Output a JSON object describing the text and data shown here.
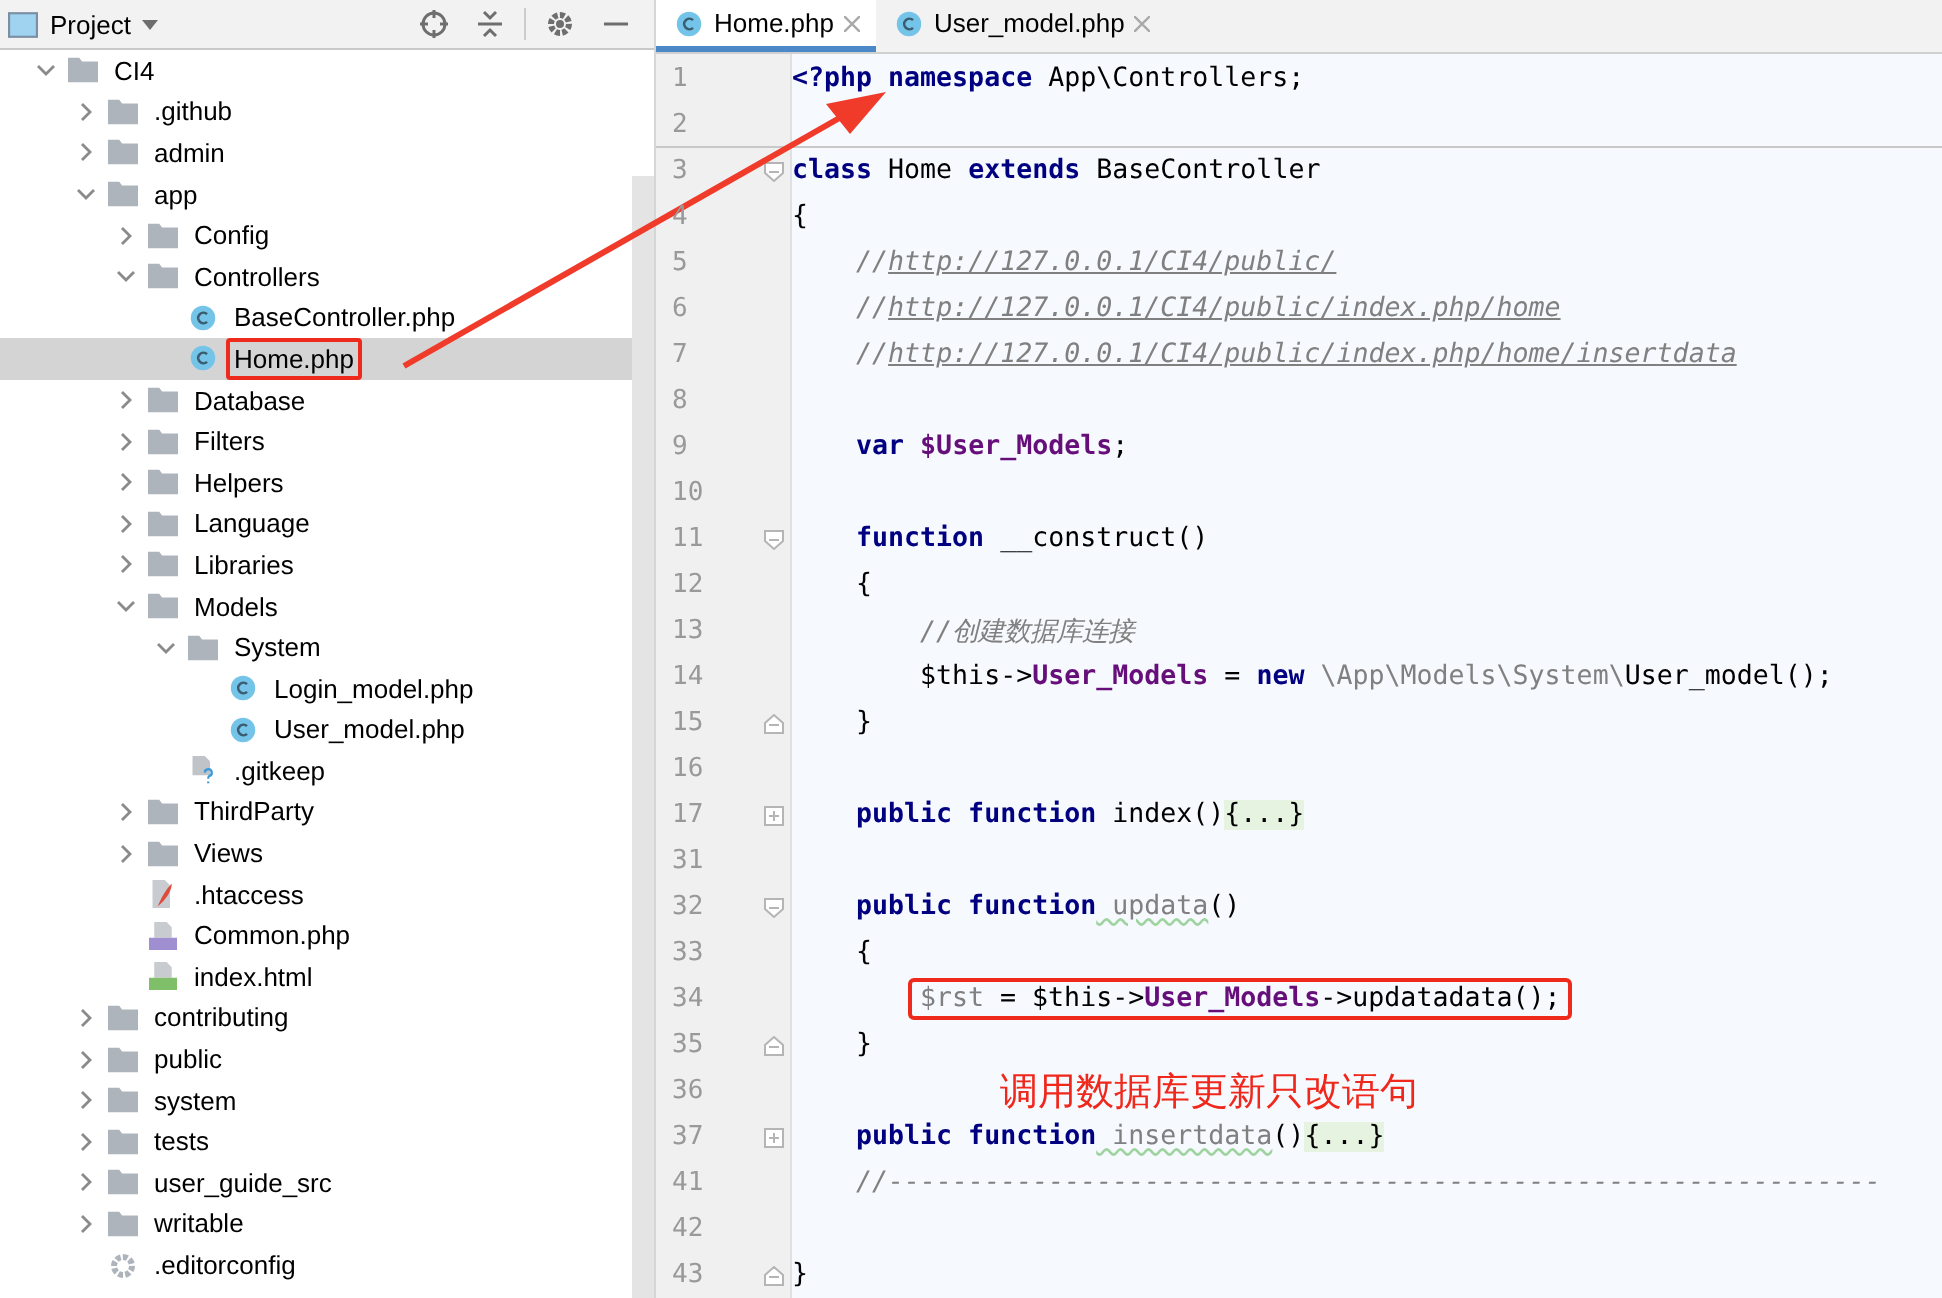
{
  "sidebar": {
    "title": "Project",
    "tree": [
      {
        "label": "CI4",
        "kind": "folder",
        "expanded": true,
        "selected": false,
        "highlighted": false,
        "children": [
          {
            "label": ".github",
            "kind": "folder",
            "expanded": false,
            "selected": false,
            "highlighted": false
          },
          {
            "label": "admin",
            "kind": "folder",
            "expanded": false,
            "selected": false,
            "highlighted": false
          },
          {
            "label": "app",
            "kind": "folder",
            "expanded": true,
            "selected": false,
            "highlighted": false,
            "children": [
              {
                "label": "Config",
                "kind": "folder",
                "expanded": false,
                "selected": false,
                "highlighted": false
              },
              {
                "label": "Controllers",
                "kind": "folder",
                "expanded": true,
                "selected": false,
                "highlighted": false,
                "children": [
                  {
                    "label": "BaseController.php",
                    "kind": "class",
                    "selected": false,
                    "highlighted": false
                  },
                  {
                    "label": "Home.php",
                    "kind": "class",
                    "selected": true,
                    "highlighted": true
                  }
                ]
              },
              {
                "label": "Database",
                "kind": "folder",
                "expanded": false,
                "selected": false,
                "highlighted": false
              },
              {
                "label": "Filters",
                "kind": "folder",
                "expanded": false,
                "selected": false,
                "highlighted": false
              },
              {
                "label": "Helpers",
                "kind": "folder",
                "expanded": false,
                "selected": false,
                "highlighted": false
              },
              {
                "label": "Language",
                "kind": "folder",
                "expanded": false,
                "selected": false,
                "highlighted": false
              },
              {
                "label": "Libraries",
                "kind": "folder",
                "expanded": false,
                "selected": false,
                "highlighted": false
              },
              {
                "label": "Models",
                "kind": "folder",
                "expanded": true,
                "selected": false,
                "highlighted": false,
                "children": [
                  {
                    "label": "System",
                    "kind": "folder",
                    "expanded": true,
                    "selected": false,
                    "highlighted": false,
                    "children": [
                      {
                        "label": "Login_model.php",
                        "kind": "class",
                        "selected": false,
                        "highlighted": false
                      },
                      {
                        "label": "User_model.php",
                        "kind": "class",
                        "selected": false,
                        "highlighted": false
                      }
                    ]
                  },
                  {
                    "label": ".gitkeep",
                    "kind": "unknown",
                    "selected": false,
                    "highlighted": false
                  }
                ]
              },
              {
                "label": "ThirdParty",
                "kind": "folder",
                "expanded": false,
                "selected": false,
                "highlighted": false
              },
              {
                "label": "Views",
                "kind": "folder",
                "expanded": false,
                "selected": false,
                "highlighted": false
              },
              {
                "label": ".htaccess",
                "kind": "htaccess",
                "selected": false,
                "highlighted": false
              },
              {
                "label": "Common.php",
                "kind": "php",
                "selected": false,
                "highlighted": false
              },
              {
                "label": "index.html",
                "kind": "html",
                "selected": false,
                "highlighted": false
              }
            ]
          },
          {
            "label": "contributing",
            "kind": "folder",
            "expanded": false,
            "selected": false,
            "highlighted": false
          },
          {
            "label": "public",
            "kind": "folder",
            "expanded": false,
            "selected": false,
            "highlighted": false
          },
          {
            "label": "system",
            "kind": "folder",
            "expanded": false,
            "selected": false,
            "highlighted": false
          },
          {
            "label": "tests",
            "kind": "folder",
            "expanded": false,
            "selected": false,
            "highlighted": false
          },
          {
            "label": "user_guide_src",
            "kind": "folder",
            "expanded": false,
            "selected": false,
            "highlighted": false
          },
          {
            "label": "writable",
            "kind": "folder",
            "expanded": false,
            "selected": false,
            "highlighted": false
          },
          {
            "label": ".editorconfig",
            "kind": "config",
            "selected": false,
            "highlighted": false
          }
        ]
      }
    ]
  },
  "tabs": [
    {
      "label": "Home.php",
      "selected": true
    },
    {
      "label": "User_model.php",
      "selected": false
    }
  ],
  "code": [
    {
      "num": "1",
      "tokens": [
        {
          "kind": "kw",
          "text": "<?php namespace"
        },
        {
          "kind": "plain",
          "text": " App\\Controllers;"
        }
      ]
    },
    {
      "num": "2",
      "separator": true
    },
    {
      "num": "3",
      "fold_start": true,
      "tokens": [
        {
          "kind": "kw",
          "text": "class"
        },
        {
          "kind": "plain",
          "text": " Home "
        },
        {
          "kind": "kw",
          "text": "extends"
        },
        {
          "kind": "plain",
          "text": " BaseController"
        }
      ]
    },
    {
      "num": "4",
      "tokens": [
        {
          "kind": "plain",
          "text": "{"
        }
      ]
    },
    {
      "num": "5",
      "tokens": [
        {
          "kind": "comment",
          "text": "    //"
        },
        {
          "kind": "link",
          "text": "http://127.0.0.1/CI4/public/"
        }
      ]
    },
    {
      "num": "6",
      "tokens": [
        {
          "kind": "comment",
          "text": "    //"
        },
        {
          "kind": "link",
          "text": "http://127.0.0.1/CI4/public/index.php/home"
        }
      ]
    },
    {
      "num": "7",
      "tokens": [
        {
          "kind": "comment",
          "text": "    //"
        },
        {
          "kind": "link",
          "text": "http://127.0.0.1/CI4/public/index.php/home/insertdata"
        }
      ]
    },
    {
      "num": "8"
    },
    {
      "num": "9",
      "tokens": [
        {
          "kind": "kw",
          "text": "    var"
        },
        {
          "kind": "field",
          "text": " $User_Models"
        },
        {
          "kind": "plain",
          "text": ";"
        }
      ]
    },
    {
      "num": "10"
    },
    {
      "num": "11",
      "fold_start": true,
      "tokens": [
        {
          "kind": "kw",
          "text": "    function"
        },
        {
          "kind": "plain",
          "text": " __construct()"
        }
      ]
    },
    {
      "num": "12",
      "tokens": [
        {
          "kind": "plain",
          "text": "    {"
        }
      ]
    },
    {
      "num": "13",
      "tokens": [
        {
          "kind": "comment",
          "text": "        //创建数据库连接"
        }
      ]
    },
    {
      "num": "14",
      "tokens": [
        {
          "kind": "plain",
          "text": "        $this->"
        },
        {
          "kind": "field",
          "text": "User_Models"
        },
        {
          "kind": "plain",
          "text": " = "
        },
        {
          "kind": "kw",
          "text": "new"
        },
        {
          "kind": "dim",
          "text": " \\App\\Models\\System\\"
        },
        {
          "kind": "plain",
          "text": "User_model();"
        }
      ]
    },
    {
      "num": "15",
      "fold_end": true,
      "tokens": [
        {
          "kind": "plain",
          "text": "    }"
        }
      ]
    },
    {
      "num": "16"
    },
    {
      "num": "17",
      "collapsed": true,
      "tokens": [
        {
          "kind": "kw",
          "text": "    public function"
        },
        {
          "kind": "plain",
          "text": " index()"
        },
        {
          "kind": "folded",
          "text": "{...}"
        }
      ]
    },
    {
      "num": "31"
    },
    {
      "num": "32",
      "fold_start": true,
      "tokens": [
        {
          "kind": "kw",
          "text": "    public function"
        },
        {
          "kind": "unused",
          "text": " updata"
        },
        {
          "kind": "plain",
          "text": "()"
        }
      ]
    },
    {
      "num": "33",
      "tokens": [
        {
          "kind": "plain",
          "text": "    {"
        }
      ]
    },
    {
      "num": "34",
      "boxed": true,
      "tokens": [
        {
          "kind": "dim",
          "text": "$rst"
        },
        {
          "kind": "plain",
          "text": " = $this->"
        },
        {
          "kind": "field",
          "text": "User_Models"
        },
        {
          "kind": "plain",
          "text": "->updatadata();"
        }
      ]
    },
    {
      "num": "35",
      "fold_end": true,
      "tokens": [
        {
          "kind": "plain",
          "text": "    }"
        }
      ]
    },
    {
      "num": "36",
      "note": "调用数据库更新只改语句"
    },
    {
      "num": "37",
      "collapsed": true,
      "tokens": [
        {
          "kind": "kw",
          "text": "    public function"
        },
        {
          "kind": "unused",
          "text": " insertdata"
        },
        {
          "kind": "plain",
          "text": "()"
        },
        {
          "kind": "folded",
          "text": "{...}"
        }
      ]
    },
    {
      "num": "41",
      "tokens": [
        {
          "kind": "comment",
          "text": "    //--------------------------------------------------------------"
        }
      ]
    },
    {
      "num": "42"
    },
    {
      "num": "43",
      "fold_end": true,
      "tokens": [
        {
          "kind": "plain",
          "text": "}"
        }
      ]
    }
  ]
}
